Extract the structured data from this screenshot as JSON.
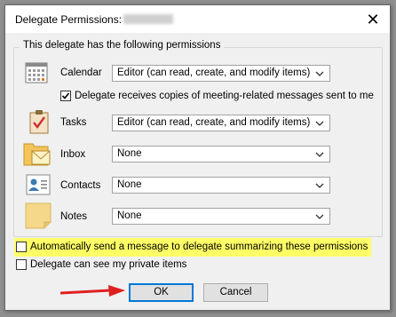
{
  "dialog": {
    "title": "Delegate Permissions:",
    "close_symbol": "✕"
  },
  "group": {
    "label": "This delegate has the following permissions"
  },
  "rows": [
    {
      "key": "calendar",
      "label": "Calendar",
      "icon": "calendar-icon",
      "value": "Editor (can read, create, and modify items)"
    },
    {
      "key": "tasks",
      "label": "Tasks",
      "icon": "tasks-icon",
      "value": "Editor (can read, create, and modify items)"
    },
    {
      "key": "inbox",
      "label": "Inbox",
      "icon": "inbox-icon",
      "value": "None"
    },
    {
      "key": "contacts",
      "label": "Contacts",
      "icon": "contacts-icon",
      "value": "None"
    },
    {
      "key": "notes",
      "label": "Notes",
      "icon": "notes-icon",
      "value": "None"
    }
  ],
  "meeting_copies": {
    "label": "Delegate receives copies of meeting-related messages sent to me",
    "checked": true
  },
  "auto_send": {
    "label": "Automatically send a message to delegate summarizing these permissions",
    "checked": false,
    "highlight_color": "#ffff66"
  },
  "private_items": {
    "label": "Delegate can see my private items",
    "checked": false
  },
  "buttons": {
    "ok": "OK",
    "cancel": "Cancel"
  },
  "annotation": {
    "arrow_color": "#e02020"
  }
}
